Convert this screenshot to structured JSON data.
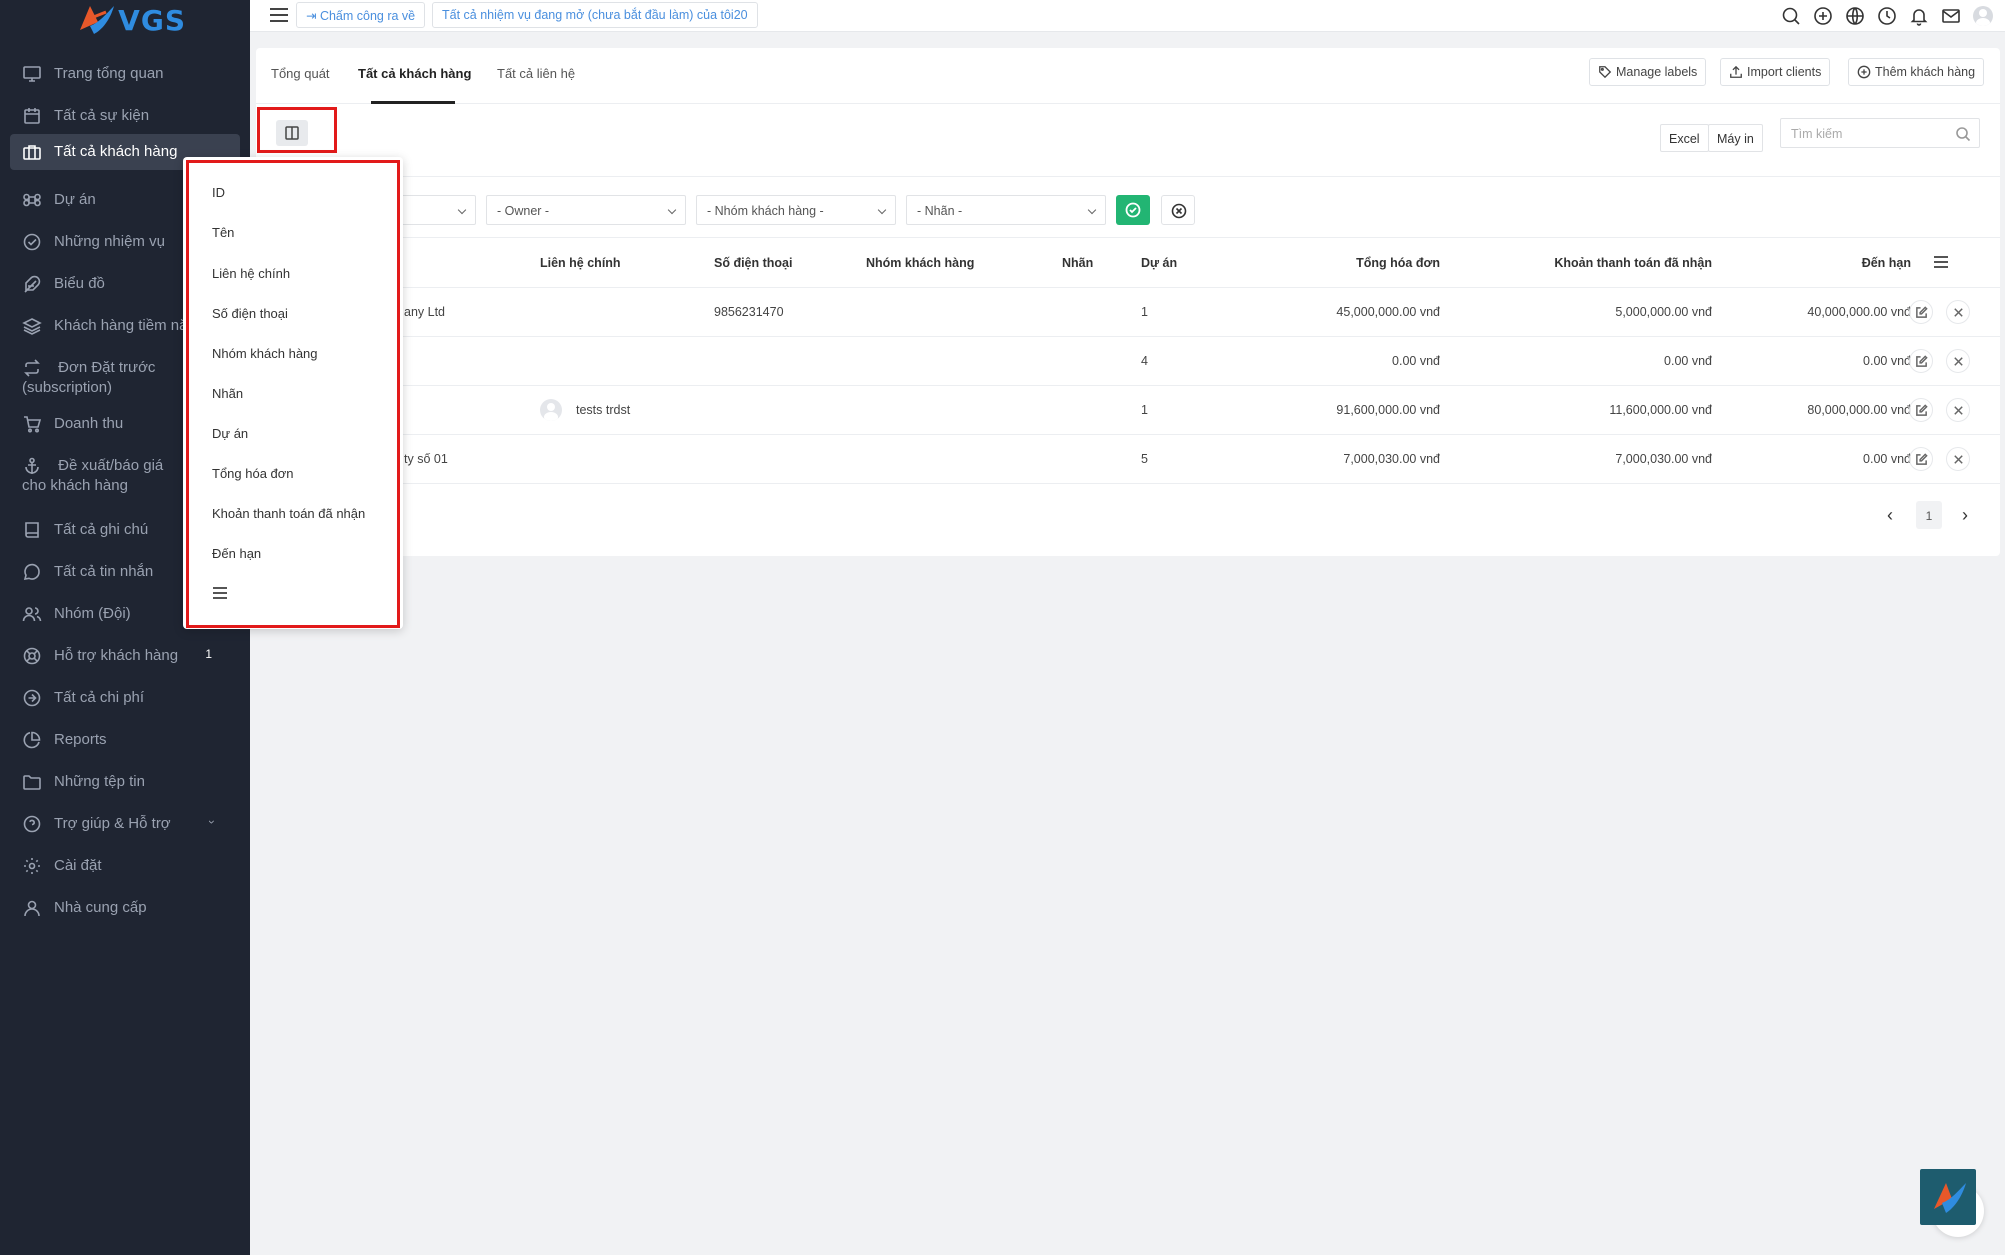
{
  "app": {
    "brand": "VGS"
  },
  "sidebar": {
    "items": [
      {
        "label": "Trang tổng quan",
        "icon": "monitor-icon"
      },
      {
        "label": "Tất cả sự kiện",
        "icon": "calendar-icon"
      },
      {
        "label": "Tất cả khách hàng",
        "icon": "briefcase-icon",
        "active": true
      },
      {
        "label": "Dự án",
        "icon": "command-icon"
      },
      {
        "label": "Những nhiệm vụ",
        "icon": "check-circle-icon"
      },
      {
        "label": "Biểu đồ",
        "icon": "feather-icon"
      },
      {
        "label": "Khách hàng tiềm năng",
        "icon": "layers-icon"
      },
      {
        "label": "Đơn Đặt trước (subscription)",
        "icon": "repeat-icon"
      },
      {
        "label": "Doanh thu",
        "icon": "cart-icon"
      },
      {
        "label": "Đề xuất/báo giá cho khách hàng",
        "icon": "anchor-icon"
      },
      {
        "label": "Tất cả ghi chú",
        "icon": "book-icon"
      },
      {
        "label": "Tất cả tin nhắn",
        "icon": "message-icon"
      },
      {
        "label": "Nhóm (Đội)",
        "icon": "users-icon"
      },
      {
        "label": "Hỗ trợ khách hàng",
        "icon": "life-buoy-icon",
        "badge": "1"
      },
      {
        "label": "Tất cả chi phí",
        "icon": "arrow-right-circle-icon"
      },
      {
        "label": "Reports",
        "icon": "pie-chart-icon"
      },
      {
        "label": "Những tệp tin",
        "icon": "folder-icon"
      },
      {
        "label": "Trợ giúp & Hỗ trợ",
        "icon": "help-circle-icon",
        "chevron": "›"
      },
      {
        "label": "Cài đặt",
        "icon": "settings-icon"
      },
      {
        "label": "Nhà cung cấp",
        "icon": "user-icon"
      }
    ]
  },
  "topbar": {
    "clock_out": "Chấm công ra về",
    "open_tasks": "Tất cả nhiệm vụ đang mở (chưa bắt đầu làm) của tôi20"
  },
  "tabs": [
    {
      "label": "Tổng quát"
    },
    {
      "label": "Tất cả khách hàng",
      "active": true
    },
    {
      "label": "Tất cả liên hệ"
    }
  ],
  "toolbar": {
    "manage_labels": "Manage labels",
    "import_clients": "Import clients",
    "add_client": "Thêm khách hàng",
    "excel": "Excel",
    "print": "Máy in",
    "search_placeholder": "Tìm kiếm"
  },
  "filters": {
    "owner": "- Owner -",
    "client_group": "- Nhóm khách hàng -",
    "label": "- Nhãn -"
  },
  "table": {
    "headers": {
      "primary_contact": "Liên hệ chính",
      "phone": "Số điện thoại",
      "client_group": "Nhóm khách hàng",
      "labels": "Nhãn",
      "projects": "Dự án",
      "total_invoiced": "Tổng hóa đơn",
      "payment_received": "Khoản thanh toán đã nhận",
      "due": "Đến hạn"
    },
    "rows": [
      {
        "name_partial": "any Ltd",
        "contact": "",
        "phone": "9856231470",
        "projects": "1",
        "total": "45,000,000.00 vnđ",
        "received": "5,000,000.00 vnđ",
        "due": "40,000,000.00 vnđ"
      },
      {
        "name_partial": "",
        "contact": "",
        "phone": "",
        "projects": "4",
        "total": "0.00 vnđ",
        "received": "0.00 vnđ",
        "due": "0.00 vnđ"
      },
      {
        "name_partial": "",
        "contact": "tests trdst",
        "phone": "",
        "projects": "1",
        "total": "91,600,000.00 vnđ",
        "received": "11,600,000.00 vnđ",
        "due": "80,000,000.00 vnđ"
      },
      {
        "name_partial": "ty số 01",
        "contact": "",
        "phone": "",
        "projects": "5",
        "total": "7,000,030.00 vnđ",
        "received": "7,000,030.00 vnđ",
        "due": "0.00 vnđ"
      }
    ]
  },
  "pagination": {
    "current": "1",
    "prev": "‹",
    "next": "›"
  },
  "column_menu": {
    "items": [
      "ID",
      "Tên",
      "Liên hệ chính",
      "Số điện thoại",
      "Nhóm khách hàng",
      "Nhãn",
      "Dự án",
      "Tổng hóa đơn",
      "Khoản thanh toán đã nhận",
      "Đến hạn"
    ]
  },
  "colors": {
    "sidebar_bg": "#1f2532",
    "accent": "#2f8ce0",
    "apply_green": "#22b573",
    "highlight_red": "#e21a1a"
  }
}
